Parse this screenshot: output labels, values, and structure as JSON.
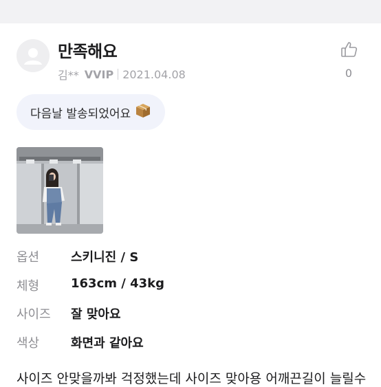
{
  "review": {
    "title": "만족해요",
    "author": "김**",
    "grade": "VVIP",
    "date": "2021.04.08",
    "like_count": "0",
    "shipping_chip": "다음날 발송되었어요",
    "photo_icon": "review-photo",
    "options": [
      {
        "label": "옵션",
        "value": "스키니진 / S"
      },
      {
        "label": "체형",
        "value": "163cm / 43kg"
      },
      {
        "label": "사이즈",
        "value": "잘 맞아요"
      },
      {
        "label": "색상",
        "value": "화면과 같아요"
      }
    ],
    "body_text": "사이즈 안맞을까봐 걱정했는데 사이즈 맞아용 어깨끈길이 늘릴수"
  },
  "icons": {
    "avatar": "user-avatar-icon",
    "like": "thumbs-up-icon",
    "package": "package-icon"
  },
  "colors": {
    "background": "#ffffff",
    "top_strip": "#f2f2f4",
    "chip_bg": "#f1f3fb",
    "muted_text": "#a3a3a8",
    "label_text": "#8e8e93",
    "primary_text": "#1c1c1e"
  }
}
